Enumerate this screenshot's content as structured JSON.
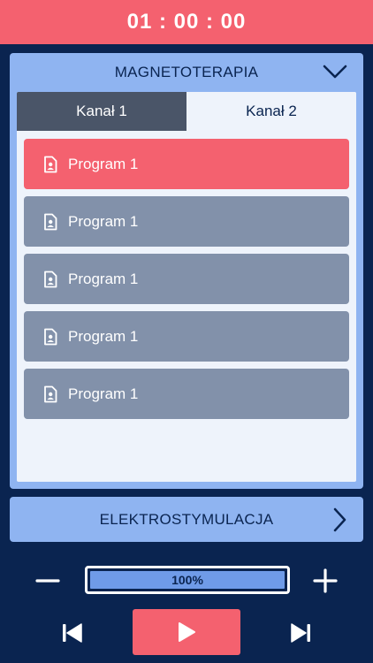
{
  "timer": {
    "value": "01 : 00 : 00"
  },
  "panel": {
    "title": "MAGNETOTERAPIA",
    "tabs": [
      {
        "label": "Kanał 1",
        "active": false
      },
      {
        "label": "Kanał 2",
        "active": true
      }
    ],
    "programs": [
      {
        "label": "Program 1",
        "selected": true,
        "icon": "file-person-icon"
      },
      {
        "label": "Program 1",
        "selected": false,
        "icon": "file-person-icon"
      },
      {
        "label": "Program 1",
        "selected": false,
        "icon": "file-person-icon"
      },
      {
        "label": "Program 1",
        "selected": false,
        "icon": "file-person-icon"
      },
      {
        "label": "Program 1",
        "selected": false,
        "icon": "file-person-icon"
      }
    ]
  },
  "secondary": {
    "title": "ELEKTROSTYMULACJA"
  },
  "controls": {
    "intensity_label": "100%",
    "intensity_fraction": 1.0
  },
  "colors": {
    "accent": "#f4616f",
    "panel": "#8fb4f1",
    "navy": "#0a2450",
    "row": "#8291aa",
    "tab_inactive": "#4a5568",
    "progress": "#6f9be8"
  }
}
